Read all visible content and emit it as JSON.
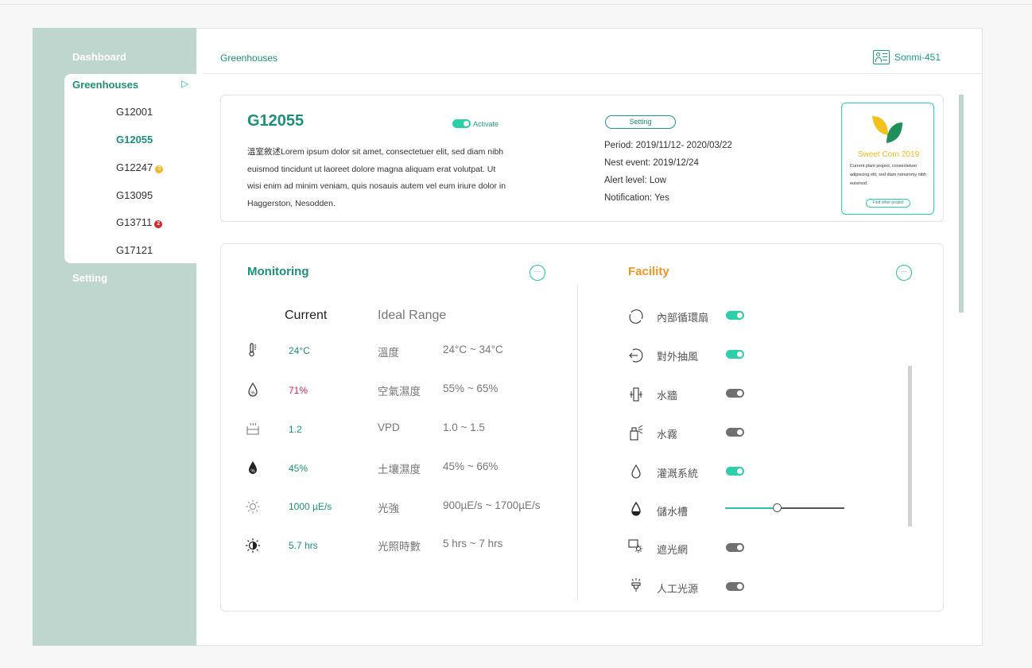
{
  "sidebar": {
    "dashboard": "Dashboard",
    "greenhouses": "Greenhouses",
    "items": [
      {
        "label": "G12001",
        "badge": ""
      },
      {
        "label": "G12055",
        "badge": ""
      },
      {
        "label": "G12247",
        "badge": "3"
      },
      {
        "label": "G13095",
        "badge": ""
      },
      {
        "label": "G13711",
        "badge": "2"
      },
      {
        "label": "G17121",
        "badge": ""
      }
    ],
    "setting": "Setting"
  },
  "header": {
    "breadcrumb": "Greenhouses",
    "user": "Sonmi-451"
  },
  "greenhouse": {
    "title": "G12055",
    "activate": "Activate",
    "description": "溫室敘述Lorem ipsum dolor sit amet, consectetuer elit, sed diam nibh euismod tincidunt ut laoreet dolore magna aliquam erat volutpat. Ut wisi enim ad minim veniam, quis nosauis autem vel eum iriure dolor in Haggerston, Nesodden.",
    "setting_button": "Setting",
    "period": "Period: 2019/11/12- 2020/03/22",
    "next_event": "Nest event: 2019/12/24",
    "alert": "Alert level: Low",
    "notification": "Notification: Yes"
  },
  "project": {
    "title": "Sweet Corn 2019",
    "description": "Current plant project, consectetuer adipiscing elit, sed diam nonummy nibh euismod.",
    "button": "Find other project"
  },
  "monitoring": {
    "title": "Monitoring",
    "more": "···",
    "current_label": "Current",
    "ideal_label": "Ideal Range",
    "rows": [
      {
        "icon": "thermometer-icon",
        "value": "24°C",
        "name": "溫度",
        "range": "24°C ~ 34°C",
        "color": "#1f8e7a"
      },
      {
        "icon": "humidity-icon",
        "value": "71%",
        "name": "空氣濕度",
        "range": "55% ~ 65%",
        "color": "#d0245f"
      },
      {
        "icon": "vpd-icon",
        "value": "1.2",
        "name": "VPD",
        "range": "1.0 ~ 1.5",
        "color": "#1f8e7a"
      },
      {
        "icon": "soil-moisture-icon",
        "value": "45%",
        "name": "土壤濕度",
        "range": "45% ~ 66%",
        "color": "#1f8e7a"
      },
      {
        "icon": "sun-icon",
        "value": "1000 µE/s",
        "name": "光強",
        "range": "900µE/s ~ 1700µE/s",
        "color": "#1f8e7a"
      },
      {
        "icon": "light-hours-icon",
        "value": "5.7 hrs",
        "name": "光照時數",
        "range": "5 hrs ~ 7 hrs",
        "color": "#1f8e7a"
      }
    ]
  },
  "facility": {
    "title": "Facility",
    "more": "···",
    "rows": [
      {
        "icon": "circulation-fan-icon",
        "name": "內部循環扇",
        "on": true
      },
      {
        "icon": "exhaust-fan-icon",
        "name": "對外抽風",
        "on": true
      },
      {
        "icon": "water-wall-icon",
        "name": "水牆",
        "on": false
      },
      {
        "icon": "mist-icon",
        "name": "水霧",
        "on": false
      },
      {
        "icon": "irrigation-icon",
        "name": "灌溉系統",
        "on": true
      },
      {
        "icon": "water-tank-icon",
        "name": "儲水槽",
        "level": 0.43
      },
      {
        "icon": "shade-net-icon",
        "name": "遮光網",
        "on": false
      },
      {
        "icon": "artificial-light-icon",
        "name": "人工光源",
        "on": false
      }
    ]
  },
  "colors": {
    "accent": "#1f8e7a",
    "sidebar": "#bfd6cf",
    "facility_title": "#f0962a",
    "toggle_on": "#2ccfaa",
    "toggle_off": "#707070"
  }
}
